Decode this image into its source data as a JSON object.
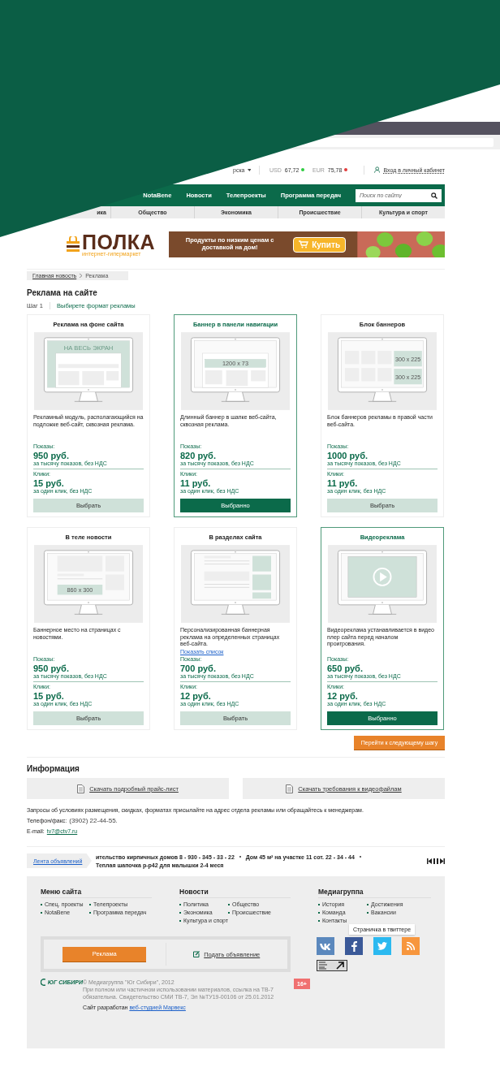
{
  "header": {
    "region_fragment": "рска",
    "currency": [
      {
        "code": "USD",
        "value": "67,72",
        "color": "#2ecc40"
      },
      {
        "code": "EUR",
        "value": "75,78",
        "color": "#e23c3c"
      }
    ],
    "login": "Вход в личный кабинет"
  },
  "nav": {
    "items": [
      "NotaBene",
      "Новости",
      "Телепроекты",
      "Программа передач"
    ],
    "search": {
      "placeholder": "Поиск по сайту"
    }
  },
  "subnav": [
    "ика",
    "Общество",
    "Экономика",
    "Происшествие",
    "Культура и спорт"
  ],
  "banner": {
    "brand": "ПОЛКА",
    "subtitle": "интернет-гипермаркет",
    "slogan": "Продукты по низким ценам с доставкой на дом!",
    "button": "Купить"
  },
  "breadcrumb": [
    "Главная новость",
    "Реклама"
  ],
  "title": "Реклама на сайте",
  "step": {
    "label": "Шаг 1",
    "text": "Выбирете формат рекламы"
  },
  "cards": [
    {
      "title": "Реклама на фоне сайта",
      "kind": "fullscreen",
      "screen_labels": [
        "НА ВЕСЬ ЭКРАН"
      ],
      "description": "Рекламный модуль, располагающийся на подложке веб-сайт, сквозная реклама.",
      "views_label": "Показы:",
      "views_price": "950 руб.",
      "views_note": "за тысячу показов, без НДС",
      "clicks_label": "Клики:",
      "clicks_price": "15 руб.",
      "clicks_note": "за один клик, без НДС",
      "button": "Выбрать",
      "selected": false
    },
    {
      "title": "Баннер в панели навигации",
      "kind": "navbar",
      "screen_labels": [
        "1200 x 73"
      ],
      "description": "Длинный баннер в шапке веб-сайта, сквозная реклама.",
      "views_label": "Показы:",
      "views_price": "820 руб.",
      "views_note": "за тысячу показов, без НДС",
      "clicks_label": "Клики:",
      "clicks_price": "11 руб.",
      "clicks_note": "за один клик, без НДС",
      "button": "Выбранно",
      "selected": true
    },
    {
      "title": "Блок баннеров",
      "kind": "blocks",
      "screen_labels": [
        "300 x 225",
        "300 x 225"
      ],
      "description": "Блок баннеров рекламы в правой части веб-сайта.",
      "views_label": "Показы:",
      "views_price": "1000 руб.",
      "views_note": "за тысячу показов, без НДС",
      "clicks_label": "Клики:",
      "clicks_price": "11 руб.",
      "clicks_note": "за один клик, без НДС",
      "button": "Выбрать",
      "selected": false
    },
    {
      "title": "В теле новости",
      "kind": "inline",
      "screen_labels": [
        "860 x 300"
      ],
      "description": "Баннерное место на страницах с новостями.",
      "views_label": "Показы:",
      "views_price": "950 руб.",
      "views_note": "за тысячу показов, без НДС",
      "clicks_label": "Клики:",
      "clicks_price": "15 руб.",
      "clicks_note": "за один клик, без НДС",
      "button": "Выбрать",
      "selected": false
    },
    {
      "title": "В разделах сайта",
      "kind": "sections",
      "description": "Персонализированная баннерная реклама на определенных страницах веб-сайта.",
      "link": "Показать список",
      "views_label": "Показы:",
      "views_price": "700 руб.",
      "views_note": "за тысячу показов, без НДС",
      "clicks_label": "Клики:",
      "clicks_price": "12 руб.",
      "clicks_note": "за один клик, без НДС",
      "button": "Выбрать",
      "selected": false
    },
    {
      "title": "Видеореклама",
      "kind": "video",
      "description": "Видеореклама устанавливается в видео плер сайта перед началом проигрования.",
      "views_label": "Показы:",
      "views_price": "650 руб.",
      "views_note": "за тысячу показов, без НДС",
      "clicks_label": "Клики:",
      "clicks_price": "12 руб.",
      "clicks_note": "за один клик, без НДС",
      "button": "Выбранно",
      "selected": true
    }
  ],
  "next_button": "Перейти к следующему шагу",
  "info": {
    "title": "Информация",
    "downloads": [
      "Скачать подробный прайс-лист",
      "Скачать требования к видеофайлам"
    ],
    "note": "Запросы об условиях размещения, скидках, форматах присылайте на адрес отдела рекламы или обращайтесь к менеджерам.",
    "phone_label": "Телефон/факс:",
    "phone": "(3902) 22-44-55.",
    "email_label": "E-mail:",
    "email": "tv7@ctv7.ru"
  },
  "ticker": {
    "tab": "Лента объявлений",
    "items": [
      "ительство кирпичных домов 8 - 930 - 345 - 33 - 22",
      "Дом 45 м² на участке 11 сот. 22 - 34 - 44",
      "Теплая шапочка р-р42 для малышки 2-4 меся"
    ]
  },
  "footer": {
    "columns": [
      {
        "title": "Меню сайта",
        "links": [
          "Спец. проекты",
          "Телепроекты",
          "NotaBene",
          "Программа передач"
        ]
      },
      {
        "title": "Новости",
        "links": [
          "Политика",
          "Общество",
          "Экономика",
          "Происшествие",
          "Культура и спорт"
        ]
      },
      {
        "title": "Медиагруппа",
        "links": [
          "История",
          "Достижения",
          "Команда",
          "Вакансии",
          "Контакты"
        ]
      }
    ],
    "ad_button": "Реклама",
    "post_ad": "Подать объявление",
    "social": [
      {
        "kind": "vk",
        "color": "#5b88bd"
      },
      {
        "kind": "facebook",
        "color": "#3b5998"
      },
      {
        "kind": "twitter",
        "color": "#2bb9f0"
      },
      {
        "kind": "rss",
        "color": "#f7963d"
      }
    ],
    "tooltip": "Страничка в твиттере",
    "logo": "ЮГ СИБИРИ",
    "copyright": "© Медиагруппа \"Юг Сибири\", 2012",
    "legal": "При полном или частичном использовании материалов, ссылка на ТВ-7 обязательна. Свидетельство СМИ ТВ-7, Эл №ТУ19-00106 от 25.01.2012",
    "age": "16+",
    "developer": "Сайт разработан",
    "developer_link": "веб-студией Марвекс"
  }
}
